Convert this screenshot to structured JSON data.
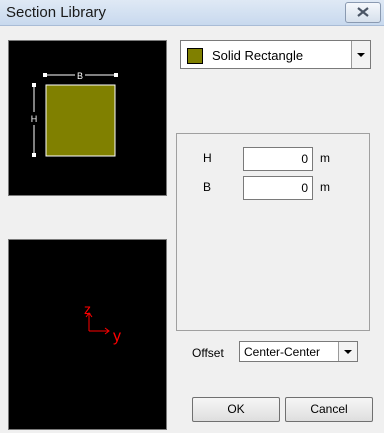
{
  "window": {
    "title": "Section Library",
    "close_icon": "close-icon"
  },
  "section": {
    "selected": "Solid Rectangle",
    "swatch_color": "#808000"
  },
  "preview": {
    "dim_b_label": "B",
    "dim_h_label": "H",
    "fill_color": "#808000",
    "axis_z": "z",
    "axis_y": "y",
    "axis_color": "#ff0000"
  },
  "params": [
    {
      "label": "H",
      "value": "0",
      "unit": "m"
    },
    {
      "label": "B",
      "value": "0",
      "unit": "m"
    }
  ],
  "offset": {
    "label": "Offset",
    "selected": "Center-Center"
  },
  "buttons": {
    "ok": "OK",
    "cancel": "Cancel"
  }
}
